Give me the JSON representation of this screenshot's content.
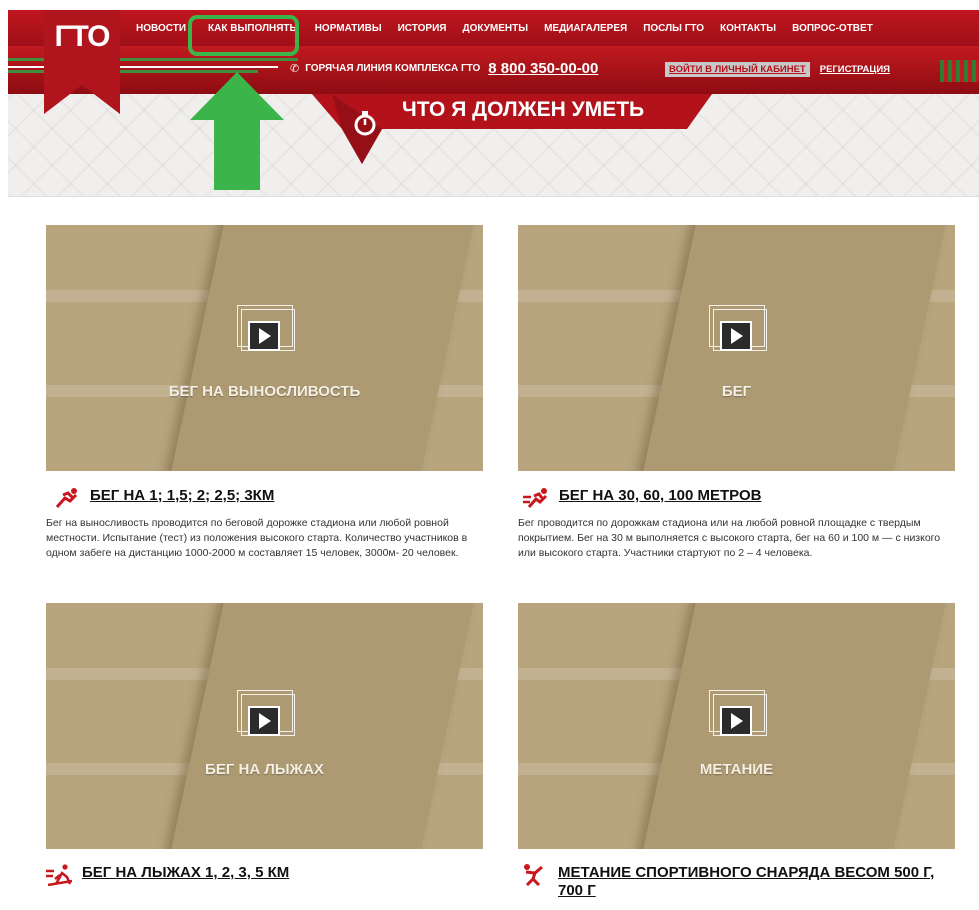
{
  "logo": "ГТО",
  "nav": [
    "НОВОСТИ",
    "КАК ВЫПОЛНЯТЬ",
    "НОРМАТИВЫ",
    "ИСТОРИЯ",
    "ДОКУМЕНТЫ",
    "МЕДИАГАЛЕРЕЯ",
    "ПОСЛЫ ГТО",
    "КОНТАКТЫ",
    "ВОПРОС-ОТВЕТ"
  ],
  "hotline": {
    "label": "ГОРЯЧАЯ ЛИНИЯ КОМПЛЕКСА ГТО",
    "phone": "8 800 350-00-00"
  },
  "account": {
    "login": "ВОЙТИ В ЛИЧНЫЙ КАБИНЕТ",
    "register": "РЕГИСТРАЦИЯ"
  },
  "page_title": "ЧТО Я ДОЛЖЕН УМЕТЬ",
  "colors": {
    "brand_red": "#b3121b",
    "highlight_green": "#3bb54a"
  },
  "cards": [
    {
      "video_label": "БЕГ НА ВЫНОСЛИВОСТЬ",
      "title": "БЕГ НА 1; 1,5; 2; 2,5; 3КМ",
      "icon": "running-icon",
      "desc": "Бег на выносливость проводится по беговой дорожке стадиона или любой ровной местности. Испытание (тест) из положения высокого старта. Количество участников в одном забеге на дистанцию 1000-2000 м составляет 15 человек, 3000м- 20 человек."
    },
    {
      "video_label": "БЕГ",
      "title": "БЕГ НА 30, 60, 100 МЕТРОВ",
      "icon": "sprint-icon",
      "desc": "Бег проводится по дорожкам стадиона или на любой ровной площадке с твердым покрытием. Бег на 30 м выполняется с высокого старта, бег на 60 и 100 м — с низкого или высокого старта. Участники стартуют по 2 – 4 человека."
    },
    {
      "video_label": "БЕГ НА ЛЫЖАХ",
      "title": "БЕГ НА ЛЫЖАХ 1, 2, 3, 5 КМ",
      "icon": "skiing-icon",
      "desc": ""
    },
    {
      "video_label": "МЕТАНИЕ",
      "title": "МЕТАНИЕ СПОРТИВНОГО СНАРЯДА ВЕСОМ 500 Г, 700 Г",
      "icon": "throwing-icon",
      "desc": ""
    }
  ]
}
